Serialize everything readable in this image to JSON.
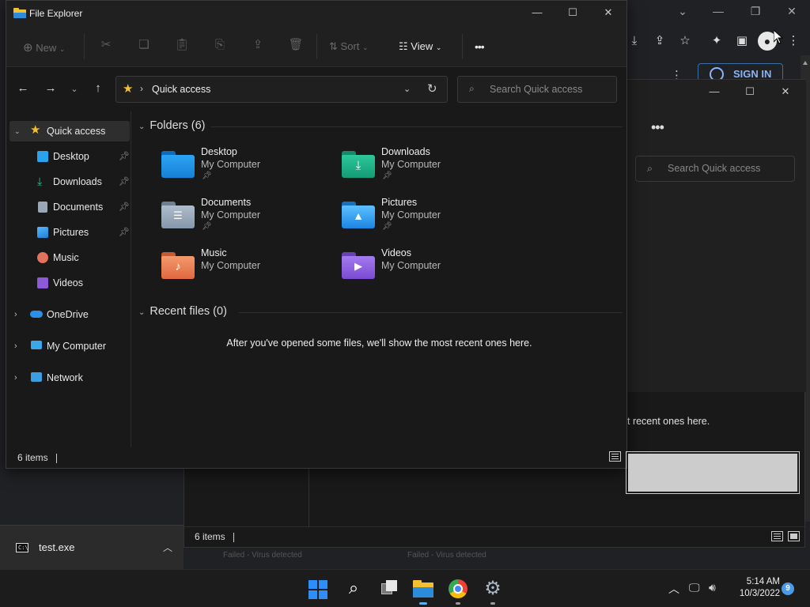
{
  "explorer_front": {
    "title": "File Explorer",
    "toolbar": {
      "new_label": "New",
      "sort_label": "Sort",
      "view_label": "View",
      "more_label": "•••"
    },
    "address": {
      "location": "Quick access",
      "separator": "›"
    },
    "search": {
      "placeholder": "Search Quick access"
    },
    "sidebar": {
      "items": [
        {
          "label": "Quick access"
        },
        {
          "label": "Desktop"
        },
        {
          "label": "Downloads"
        },
        {
          "label": "Documents"
        },
        {
          "label": "Pictures"
        },
        {
          "label": "Music"
        },
        {
          "label": "Videos"
        },
        {
          "label": "OneDrive"
        },
        {
          "label": "My Computer"
        },
        {
          "label": "Network"
        }
      ]
    },
    "folders_header": "Folders (6)",
    "folders": [
      {
        "name": "Desktop",
        "location": "My Computer",
        "pinned": true,
        "color": "#1e96f0"
      },
      {
        "name": "Downloads",
        "location": "My Computer",
        "pinned": true,
        "color": "#1fb38a"
      },
      {
        "name": "Documents",
        "location": "My Computer",
        "pinned": true,
        "color": "#8fa3b8"
      },
      {
        "name": "Pictures",
        "location": "My Computer",
        "pinned": true,
        "color": "#2a9df2"
      },
      {
        "name": "Music",
        "location": "My Computer",
        "pinned": false,
        "color": "#e8794a"
      },
      {
        "name": "Videos",
        "location": "My Computer",
        "pinned": false,
        "color": "#8a5ad8"
      }
    ],
    "recent_header": "Recent files (0)",
    "recent_empty": "After you've opened some files, we'll show the most recent ones here.",
    "status": "6 items"
  },
  "explorer_back": {
    "more_label": "•••",
    "search_placeholder": "Search Quick access",
    "recent_hint_fragment": "t recent ones here.",
    "status": "6 items"
  },
  "chrome": {
    "sign_in": "SIGN IN"
  },
  "download_bar": {
    "file_name": "test.exe",
    "faded_status_1": "Failed - Virus detected",
    "faded_status_2": "Failed - Virus detected"
  },
  "taskbar": {
    "time": "5:14 AM",
    "date": "10/3/2022",
    "notifications": "9"
  },
  "colors": {
    "folder_tab_yellow": "#f4c033",
    "accent": "#2e8ef7"
  }
}
